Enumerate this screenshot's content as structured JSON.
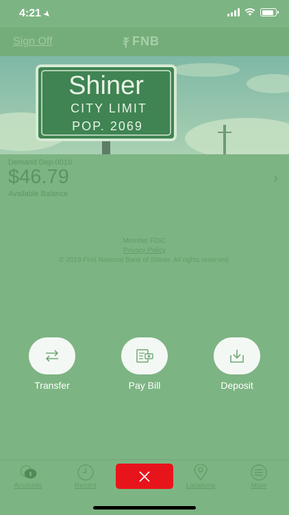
{
  "status_bar": {
    "time": "4:21",
    "location_icon": "location-arrow-icon",
    "battery_fraction": 0.85
  },
  "header": {
    "sign_off": "Sign Off",
    "logo_text": "FNB"
  },
  "hero": {
    "sign_line1": "Shiner",
    "sign_line2": "CITY LIMIT",
    "sign_line3": "POP. 2069"
  },
  "account": {
    "name": "Demand Dep-0010",
    "balance": "$46.79",
    "balance_label": "Available Balance"
  },
  "footer_info": {
    "member": "Member FDIC",
    "privacy": "Privacy Policy",
    "copyright": "© 2019 First National Bank of Shiner. All rights reserved."
  },
  "actions": [
    {
      "label": "Transfer",
      "icon": "transfer-arrows-icon"
    },
    {
      "label": "Pay Bill",
      "icon": "pay-bill-icon"
    },
    {
      "label": "Deposit",
      "icon": "deposit-tray-icon"
    }
  ],
  "tabbar": {
    "items": [
      {
        "label": "Accounts",
        "icon": "accounts-icon"
      },
      {
        "label": "Recent",
        "icon": "clock-icon"
      },
      {
        "label": "Locations",
        "icon": "map-pin-icon"
      },
      {
        "label": "More",
        "icon": "menu-icon"
      }
    ],
    "close_icon": "close-icon"
  },
  "colors": {
    "overlay_green": "#7db483",
    "close_red": "#e8141c",
    "action_white": "#f4f8f4"
  }
}
